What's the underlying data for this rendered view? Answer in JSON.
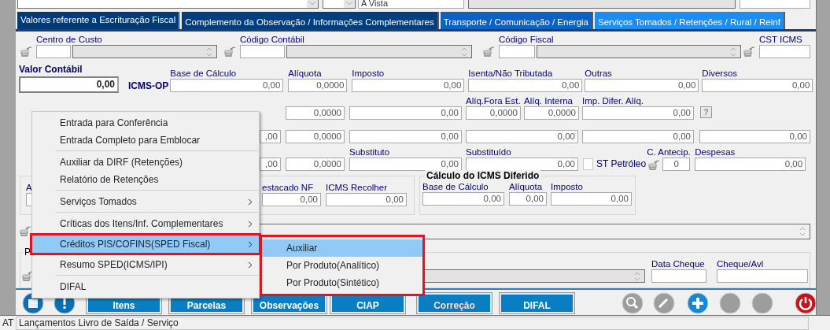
{
  "top_row": {
    "field_3": "A Vista"
  },
  "tabs": [
    {
      "label": "Valores referente a Escrituração Fiscal",
      "selected": true
    },
    {
      "label": "Complemento da Observação / Informações Complementares",
      "selected": false
    },
    {
      "label": "Transporte / Comunicação / Energia",
      "selected": false
    },
    {
      "label": "Serviços Tomados / Retenções / Rural / Reinf",
      "selected": false
    }
  ],
  "lookups": [
    {
      "label": "Centro de Custo"
    },
    {
      "label": "Código Contábil"
    },
    {
      "label": "Código Fiscal"
    },
    {
      "label": "CST ICMS"
    }
  ],
  "valor_contabil": {
    "label": "Valor Contábil",
    "value": "0,00"
  },
  "icms_op": {
    "label": "ICMS-OP",
    "column_headers": [
      "Base de Cálculo",
      "Alíquota",
      "Imposto",
      "Isenta/Não Tributada",
      "Outras",
      "Diversos"
    ],
    "values": [
      "0,00",
      "0,0000",
      "0,00",
      "0,00",
      "0,00",
      "0,00"
    ]
  },
  "difal_row": {
    "fields": [
      {
        "value": "0,0000"
      },
      {
        "value": "0,00"
      },
      {
        "label": "Alíq.Fora Est.",
        "value": "0,0000"
      },
      {
        "label": "Alíq. Interna",
        "value": "0,0000"
      },
      {
        "label": "Imp. Difer. Alíq.",
        "value": "0,00"
      }
    ],
    "help_button": "?"
  },
  "row_4": {
    "fields": [
      {
        "value": ",00"
      },
      {
        "value": "0,0000"
      },
      {
        "value": "0,00"
      },
      {
        "value": "0,00"
      },
      {
        "value": "0,00"
      },
      {
        "value": "0,00"
      }
    ]
  },
  "row_5": {
    "column_headers": [
      "Substituto",
      "Substituído"
    ],
    "values": [
      ",00",
      "0,0000",
      "0,00",
      "0,00"
    ],
    "st_petroleo": {
      "label": "ST Petróleo",
      "checked": false
    },
    "antecip": {
      "label": "C. Antecip.",
      "value": "0"
    },
    "despesas": {
      "label": "Despesas",
      "value": "0,00"
    }
  },
  "group_1": {
    "fields": [
      {
        "label": "A"
      },
      {
        "label": "estacado NF",
        "value": "0,00"
      },
      {
        "label": "ICMS Recolher",
        "value": "0,00"
      }
    ]
  },
  "icms_diferido": {
    "title": "Cálculo do ICMS Diferido",
    "fields": [
      {
        "label": "Base de Cálculo",
        "value": "0,00"
      },
      {
        "label": "Alíquota",
        "value": "0,00"
      },
      {
        "label": "Imposto",
        "value": "0,00"
      }
    ]
  },
  "group_3": {
    "legend": "P",
    "fields": [
      {
        "label": "Data Cheque"
      },
      {
        "label": "Cheque/Avl"
      }
    ]
  },
  "toolbar_buttons": [
    {
      "label": "Itens",
      "disabled": false
    },
    {
      "label": "Parcelas",
      "disabled": false
    },
    {
      "label": "Observações",
      "disabled": false
    },
    {
      "label": "CIAP",
      "disabled": false
    },
    {
      "label": "Correção",
      "disabled": true
    },
    {
      "label": "DIFAL",
      "disabled": false
    }
  ],
  "toolbar_icons": [
    {
      "kind": "magnifier",
      "disabled": true
    },
    {
      "kind": "pencil",
      "disabled": true
    },
    {
      "kind": "plus",
      "disabled": false
    },
    {
      "kind": "blank",
      "disabled": true
    },
    {
      "kind": "blank",
      "disabled": true
    },
    {
      "kind": "power",
      "disabled": false
    }
  ],
  "context_menu": {
    "items": [
      {
        "kind": "item",
        "label": "Entrada para Conferência",
        "has_submenu": false,
        "selected": false,
        "highlighted": false
      },
      {
        "kind": "item",
        "label": "Entrada Completo para Emblocar",
        "has_submenu": false,
        "selected": false,
        "highlighted": false
      },
      {
        "kind": "separator"
      },
      {
        "kind": "item",
        "label": "Auxiliar da DIRF (Retenções)",
        "has_submenu": false,
        "selected": false,
        "highlighted": false
      },
      {
        "kind": "item",
        "label": "Relatório de Retenções",
        "has_submenu": false,
        "selected": false,
        "highlighted": false
      },
      {
        "kind": "separator"
      },
      {
        "kind": "item",
        "label": "Serviços Tomados",
        "has_submenu": true,
        "selected": false,
        "highlighted": false
      },
      {
        "kind": "separator"
      },
      {
        "kind": "item",
        "label": "Críticas dos Itens/Inf. Complementares",
        "has_submenu": true,
        "selected": false,
        "highlighted": false
      },
      {
        "kind": "item",
        "label": "Créditos PIS/COFINS(SPED Fiscal)",
        "has_submenu": true,
        "selected": true,
        "highlighted": true
      },
      {
        "kind": "item",
        "label": "Resumo SPED(ICMS/IPI)",
        "has_submenu": true,
        "selected": false,
        "highlighted": false
      },
      {
        "kind": "separator"
      },
      {
        "kind": "item",
        "label": "DIFAL",
        "has_submenu": false,
        "selected": false,
        "highlighted": false
      }
    ],
    "submenu": {
      "highlighted": true,
      "items": [
        {
          "label": "Auxiliar",
          "selected": true
        },
        {
          "label": "Por Produto(Analítico)",
          "selected": false
        },
        {
          "label": "Por Produto(Sintético)",
          "selected": false
        }
      ]
    }
  },
  "status_bar": {
    "prefix": "AT",
    "message": "Lançamentos Livro de Saída / Serviço"
  }
}
